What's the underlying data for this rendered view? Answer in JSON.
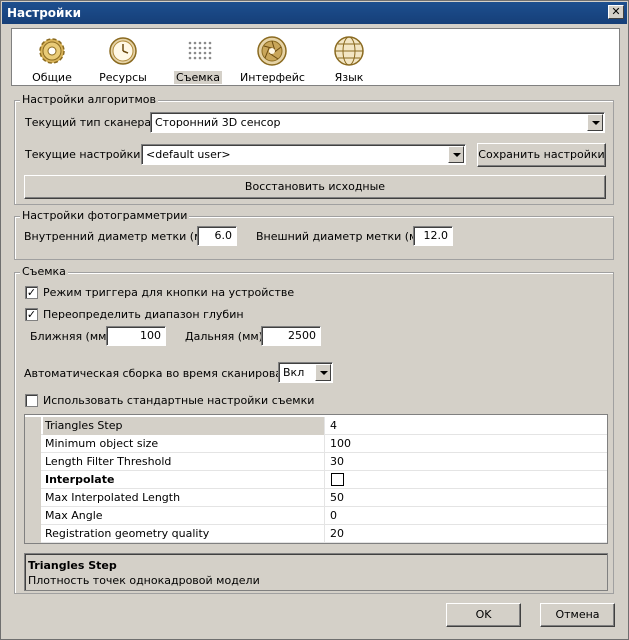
{
  "window": {
    "title": "Настройки",
    "close": "✕"
  },
  "tabs": [
    {
      "id": "general",
      "label": "Общие",
      "icon": "gear-icon"
    },
    {
      "id": "resources",
      "label": "Ресурсы",
      "icon": "clock-icon"
    },
    {
      "id": "capture",
      "label": "Съемка",
      "icon": "dot-grid-icon",
      "active": true
    },
    {
      "id": "interface",
      "label": "Интерфейс",
      "icon": "aperture-icon"
    },
    {
      "id": "language",
      "label": "Язык",
      "icon": "globe-icon"
    }
  ],
  "algo": {
    "title": "Настройки алгоритмов",
    "scanner_type_label": "Текущий тип сканера:",
    "scanner_type_value": "Сторонний 3D сенсор",
    "current_settings_label": "Текущие настройки:",
    "current_settings_value": "<default user>",
    "save_label": "Сохранить настройки",
    "restore_label": "Восстановить исходные"
  },
  "photo": {
    "title": "Настройки фотограмметрии",
    "inner_label": "Внутренний диаметр метки (мм):",
    "inner_value": "6.0",
    "outer_label": "Внешний диаметр метки (мм):",
    "outer_value": "12.0"
  },
  "capture": {
    "title": "Съемка",
    "trigger_label": "Режим триггера для кнопки на устройстве",
    "trigger_checked": true,
    "depth_label": "Переопределить диапазон глубин",
    "depth_checked": true,
    "near_label": "Ближняя (мм):",
    "near_value": "100",
    "far_label": "Дальняя (мм):",
    "far_value": "2500",
    "auto_label": "Автоматическая сборка во время сканирования:",
    "auto_value": "Вкл",
    "standard_label": "Использовать стандартные настройки съемки",
    "standard_checked": false
  },
  "properties": [
    {
      "name": "Triangles Step",
      "value": "4"
    },
    {
      "name": "Minimum object size",
      "value": "100"
    },
    {
      "name": "Length Filter Threshold",
      "value": "30"
    },
    {
      "name": "Interpolate",
      "value": ""
    },
    {
      "name": "Max Interpolated Length",
      "value": "50"
    },
    {
      "name": "Max Angle",
      "value": "0"
    },
    {
      "name": "Registration geometry quality",
      "value": "20"
    }
  ],
  "description": {
    "title": "Triangles Step",
    "text": "Плотность точек однокадровой модели"
  },
  "footer": {
    "ok": "OK",
    "cancel": "Отмена"
  }
}
